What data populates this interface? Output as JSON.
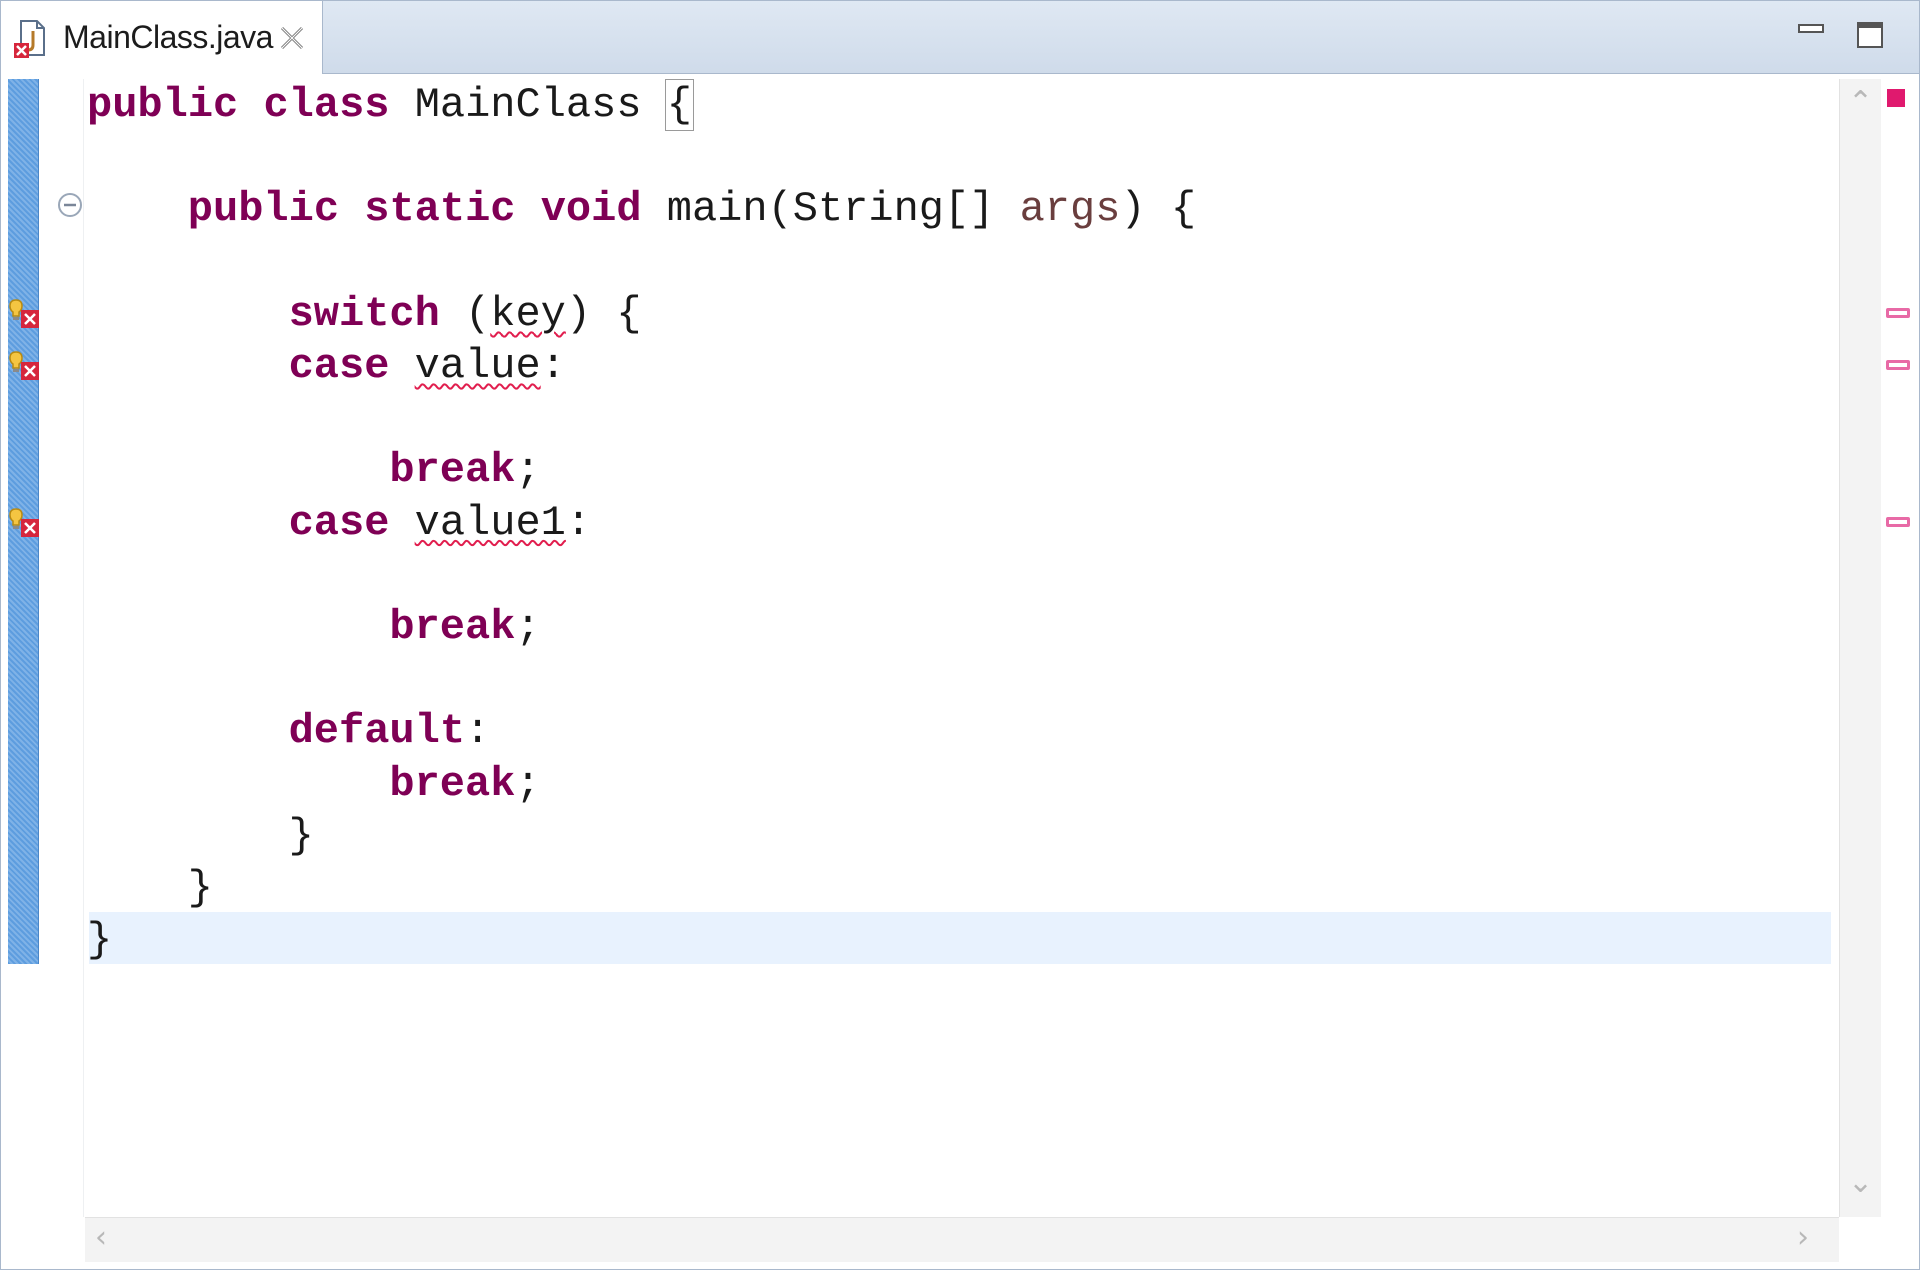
{
  "tab": {
    "label": "MainClass.java"
  },
  "code": {
    "lines": [
      {
        "indent": "",
        "tokens": [
          [
            "kw",
            "public"
          ],
          [
            "t",
            " "
          ],
          [
            "kw",
            "class"
          ],
          [
            "t",
            " MainClass "
          ],
          [
            "brace",
            "{"
          ]
        ]
      },
      {
        "indent": "",
        "tokens": []
      },
      {
        "indent": "    ",
        "tokens": [
          [
            "kw",
            "public"
          ],
          [
            "t",
            " "
          ],
          [
            "kw",
            "static"
          ],
          [
            "t",
            " "
          ],
          [
            "kw",
            "void"
          ],
          [
            "t",
            " main(String[] "
          ],
          [
            "param",
            "args"
          ],
          [
            "t",
            ") {"
          ]
        ]
      },
      {
        "indent": "",
        "tokens": []
      },
      {
        "indent": "        ",
        "tokens": [
          [
            "kw",
            "switch"
          ],
          [
            "t",
            " ("
          ],
          [
            "err",
            "key"
          ],
          [
            "t",
            ") {"
          ]
        ]
      },
      {
        "indent": "        ",
        "tokens": [
          [
            "kw",
            "case"
          ],
          [
            "t",
            " "
          ],
          [
            "err",
            "value"
          ],
          [
            "t",
            ":"
          ]
        ]
      },
      {
        "indent": "",
        "tokens": []
      },
      {
        "indent": "            ",
        "tokens": [
          [
            "kw",
            "break"
          ],
          [
            "t",
            ";"
          ]
        ]
      },
      {
        "indent": "        ",
        "tokens": [
          [
            "kw",
            "case"
          ],
          [
            "t",
            " "
          ],
          [
            "err",
            "value1"
          ],
          [
            "t",
            ":"
          ]
        ]
      },
      {
        "indent": "",
        "tokens": []
      },
      {
        "indent": "            ",
        "tokens": [
          [
            "kw",
            "break"
          ],
          [
            "t",
            ";"
          ]
        ]
      },
      {
        "indent": "",
        "tokens": []
      },
      {
        "indent": "        ",
        "tokens": [
          [
            "kw",
            "default"
          ],
          [
            "t",
            ":"
          ]
        ]
      },
      {
        "indent": "            ",
        "tokens": [
          [
            "kw",
            "break"
          ],
          [
            "t",
            ";"
          ]
        ]
      },
      {
        "indent": "        ",
        "tokens": [
          [
            "t",
            "}"
          ]
        ]
      },
      {
        "indent": "    ",
        "tokens": [
          [
            "t",
            "}"
          ]
        ]
      },
      {
        "indent": "",
        "tokens": [
          [
            "t",
            "}"
          ]
        ]
      }
    ],
    "error_lines": [
      4,
      5,
      8
    ]
  },
  "colors": {
    "keyword": "#7f0055",
    "error_underline": "#e11e4e",
    "overview_error": "#e0196e",
    "current_line": "#e8f2fe",
    "change_bar": "#5d9ddf"
  },
  "icons": {
    "file": "java-file-error-icon",
    "close": "close-icon",
    "minimize": "minimize-icon",
    "maximize": "maximize-icon",
    "fold": "collapse-icon",
    "error_marker": "error-quickfix-icon"
  }
}
